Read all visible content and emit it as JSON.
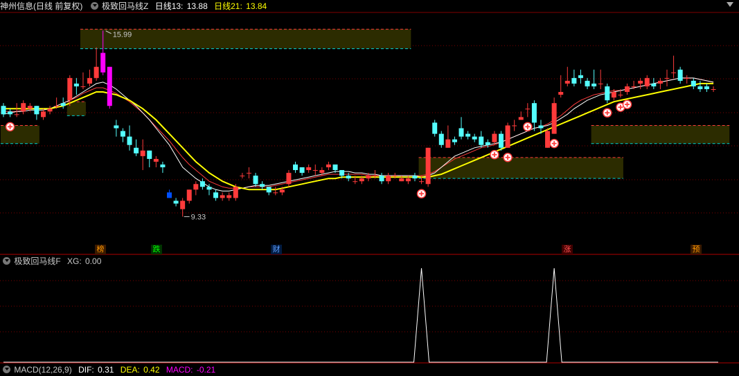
{
  "top_bar": {
    "stock_label": "神州信息(日线 前复权)",
    "indicator_name": "极致回马线Z",
    "ma13_label": "日线13:",
    "ma13_value": "13.88",
    "ma21_label": "日线21:",
    "ma21_value": "13.84"
  },
  "sub_bar": {
    "indicator_name": "极致回马线F",
    "xg_label": "XG:",
    "xg_value": "0.00"
  },
  "macd_bar": {
    "name": "MACD(12,26,9)",
    "dif_label": "DIF:",
    "dif_value": "0.31",
    "dea_label": "DEA:",
    "dea_value": "0.42",
    "macd_label": "MACD:",
    "macd_value": "-0.21"
  },
  "colors": {
    "up": "#ff3b3b",
    "down": "#54ffff",
    "ma_white": "#ffffff",
    "ma_yellow": "#ffff00",
    "ma_red": "#ff3b3b",
    "magenta": "#ff00ff",
    "zone_fill": "#2c2c00",
    "zone_top": "#ff3b3b",
    "zone_bottom": "#00d0d0",
    "grid": "#800000"
  },
  "chart_data": {
    "type": "candlestick",
    "price_range": [
      8.5,
      16.6
    ],
    "annotations": [
      {
        "text": "15.99",
        "value": 15.99,
        "kind": "high"
      },
      {
        "text": "9.33",
        "value": 9.33,
        "kind": "low"
      }
    ],
    "event_markers": [
      "榜",
      "跌",
      "财",
      "涨",
      "预"
    ],
    "candles": [
      [
        13.3,
        13.0,
        13.4,
        12.9
      ],
      [
        13.1,
        13.0,
        13.2,
        12.9
      ],
      [
        13.0,
        13.0,
        13.4,
        12.9
      ],
      [
        13.1,
        13.4,
        13.5,
        13.0
      ],
      [
        13.2,
        13.3,
        13.4,
        13.1
      ],
      [
        13.3,
        13.0,
        13.3,
        12.8
      ],
      [
        12.9,
        13.1,
        13.2,
        12.8
      ],
      [
        13.1,
        13.2,
        13.3,
        13.0
      ],
      [
        13.3,
        13.3,
        13.6,
        13.2
      ],
      [
        13.4,
        13.3,
        13.6,
        13.2
      ],
      [
        13.5,
        14.3,
        14.4,
        13.3
      ],
      [
        14.1,
        14.0,
        14.3,
        13.7
      ],
      [
        14.0,
        14.0,
        14.5,
        13.9
      ],
      [
        14.1,
        14.3,
        14.6,
        14.0
      ],
      [
        14.3,
        14.7,
        15.4,
        14.2
      ],
      [
        15.2,
        14.5,
        16.0,
        14.4
      ],
      [
        14.7,
        13.3,
        14.7,
        13.2
      ],
      [
        12.6,
        12.5,
        12.8,
        12.2
      ],
      [
        12.4,
        12.2,
        12.5,
        12.0
      ],
      [
        12.2,
        11.9,
        12.6,
        11.7
      ],
      [
        11.8,
        11.6,
        12.1,
        11.5
      ],
      [
        11.5,
        11.7,
        12.1,
        11.0
      ],
      [
        11.7,
        11.4,
        11.7,
        11.1
      ],
      [
        11.3,
        11.4,
        11.5,
        11.1
      ],
      [
        11.2,
        11.1,
        11.3,
        10.9
      ],
      [
        10.2,
        10.0,
        10.3,
        10.0
      ],
      [
        9.9,
        9.8,
        10.0,
        9.7
      ],
      [
        9.6,
        9.9,
        10.0,
        9.33
      ],
      [
        9.9,
        10.3,
        10.3,
        9.8
      ],
      [
        10.3,
        10.5,
        10.6,
        10.1
      ],
      [
        10.6,
        10.4,
        10.7,
        10.3
      ],
      [
        10.4,
        10.3,
        10.5,
        10.1
      ],
      [
        10.2,
        10.0,
        10.3,
        9.9
      ],
      [
        10.0,
        10.1,
        10.2,
        9.9
      ],
      [
        10.0,
        10.1,
        10.2,
        9.9
      ],
      [
        10.0,
        10.4,
        10.5,
        9.9
      ],
      [
        10.8,
        10.8,
        10.9,
        10.7
      ],
      [
        10.9,
        10.9,
        11.1,
        10.7
      ],
      [
        10.8,
        10.5,
        10.9,
        10.4
      ],
      [
        10.5,
        10.4,
        10.6,
        10.3
      ],
      [
        10.4,
        10.2,
        10.4,
        10.1
      ],
      [
        10.2,
        10.2,
        10.4,
        10.1
      ],
      [
        10.2,
        10.3,
        10.4,
        10.1
      ],
      [
        10.5,
        10.9,
        11.0,
        10.4
      ],
      [
        11.2,
        11.0,
        11.3,
        10.9
      ],
      [
        11.1,
        10.9,
        11.1,
        10.8
      ],
      [
        11.0,
        11.1,
        11.2,
        10.9
      ],
      [
        11.0,
        11.0,
        11.2,
        10.8
      ],
      [
        10.9,
        11.0,
        11.1,
        10.8
      ],
      [
        11.1,
        11.2,
        11.3,
        11.0
      ],
      [
        11.2,
        11.0,
        11.2,
        10.9
      ],
      [
        11.0,
        10.8,
        11.0,
        10.7
      ],
      [
        10.8,
        10.7,
        10.9,
        10.6
      ],
      [
        10.6,
        10.6,
        10.8,
        10.5
      ],
      [
        10.6,
        10.7,
        10.8,
        10.5
      ],
      [
        10.7,
        10.8,
        10.9,
        10.6
      ],
      [
        10.8,
        10.8,
        11.0,
        10.7
      ],
      [
        10.8,
        10.6,
        10.9,
        10.5
      ],
      [
        10.6,
        10.8,
        10.9,
        10.5
      ],
      [
        10.8,
        10.8,
        10.9,
        10.7
      ],
      [
        10.6,
        10.7,
        10.8,
        10.6
      ],
      [
        10.6,
        10.7,
        10.8,
        10.5
      ],
      [
        10.8,
        10.7,
        10.9,
        10.6
      ],
      [
        10.6,
        10.6,
        10.8,
        10.5
      ],
      [
        10.5,
        11.8,
        11.8,
        10.4
      ],
      [
        12.7,
        12.3,
        12.8,
        12.2
      ],
      [
        12.3,
        11.9,
        12.4,
        11.8
      ],
      [
        11.8,
        12.1,
        12.6,
        11.8
      ],
      [
        12.1,
        12.0,
        12.2,
        11.9
      ],
      [
        12.5,
        12.2,
        12.9,
        12.1
      ],
      [
        12.3,
        12.2,
        12.4,
        12.1
      ],
      [
        12.2,
        12.1,
        12.3,
        12.0
      ],
      [
        12.2,
        11.9,
        12.4,
        11.8
      ],
      [
        12.0,
        11.9,
        12.1,
        11.8
      ],
      [
        12.0,
        12.3,
        12.4,
        11.9
      ],
      [
        12.3,
        11.8,
        12.4,
        11.7
      ],
      [
        11.8,
        12.6,
        12.7,
        11.8
      ],
      [
        12.6,
        12.6,
        12.8,
        12.4
      ],
      [
        12.8,
        12.9,
        13.1,
        12.8
      ],
      [
        13.2,
        13.2,
        13.4,
        12.9
      ],
      [
        13.4,
        12.7,
        13.5,
        12.4
      ],
      [
        12.6,
        12.5,
        12.8,
        12.3
      ],
      [
        11.8,
        12.4,
        12.5,
        11.8
      ],
      [
        12.3,
        13.4,
        13.6,
        12.3
      ],
      [
        13.7,
        13.8,
        14.4,
        13.6
      ],
      [
        14.1,
        14.2,
        14.7,
        14.0
      ],
      [
        14.3,
        14.1,
        14.6,
        14.0
      ],
      [
        14.4,
        14.3,
        14.6,
        14.1
      ],
      [
        14.2,
        14.0,
        14.3,
        13.9
      ],
      [
        14.1,
        14.0,
        14.6,
        13.9
      ],
      [
        14.1,
        14.1,
        14.6,
        13.9
      ],
      [
        14.0,
        13.5,
        14.1,
        13.4
      ],
      [
        13.6,
        13.8,
        13.9,
        13.5
      ],
      [
        13.7,
        13.7,
        13.9,
        13.6
      ],
      [
        13.8,
        14.0,
        14.1,
        13.7
      ],
      [
        14.0,
        14.0,
        14.2,
        13.9
      ],
      [
        14.1,
        14.2,
        14.3,
        13.9
      ],
      [
        14.0,
        14.3,
        14.4,
        13.9
      ],
      [
        14.1,
        14.0,
        14.3,
        13.9
      ],
      [
        14.1,
        14.2,
        14.3,
        13.9
      ],
      [
        14.3,
        14.3,
        14.6,
        14.0
      ],
      [
        14.5,
        14.5,
        15.1,
        14.3
      ],
      [
        14.6,
        14.2,
        14.7,
        14.1
      ],
      [
        14.3,
        14.3,
        14.4,
        14.1
      ],
      [
        14.2,
        14.0,
        14.3,
        13.9
      ],
      [
        14.0,
        13.9,
        14.2,
        13.8
      ],
      [
        14.0,
        13.9,
        14.1,
        13.8
      ],
      [
        13.9,
        13.9,
        14.0,
        13.8
      ]
    ],
    "ma_white": [
      13.0,
      13.05,
      13.1,
      13.1,
      13.15,
      13.15,
      13.15,
      13.2,
      13.3,
      13.4,
      13.5,
      13.65,
      13.8,
      13.95,
      14.1,
      14.15,
      14.05,
      13.9,
      13.7,
      13.5,
      13.3,
      13.05,
      12.8,
      12.5,
      12.2,
      11.9,
      11.5,
      11.1,
      10.9,
      10.7,
      10.55,
      10.4,
      10.3,
      10.25,
      10.25,
      10.3,
      10.35,
      10.4,
      10.45,
      10.45,
      10.45,
      10.5,
      10.55,
      10.6,
      10.65,
      10.7,
      10.75,
      10.8,
      10.85,
      10.9,
      10.95,
      10.95,
      10.95,
      10.9,
      10.9,
      10.85,
      10.85,
      10.8,
      10.8,
      10.8,
      10.8,
      10.8,
      10.8,
      10.75,
      10.8,
      10.9,
      11.1,
      11.3,
      11.5,
      11.6,
      11.7,
      11.8,
      11.85,
      11.9,
      11.95,
      12.0,
      12.1,
      12.2,
      12.3,
      12.4,
      12.5,
      12.55,
      12.6,
      12.7,
      12.85,
      13.0,
      13.2,
      13.35,
      13.5,
      13.6,
      13.7,
      13.75,
      13.8,
      13.85,
      13.9,
      13.95,
      14.0,
      14.05,
      14.1,
      14.15,
      14.2,
      14.25,
      14.3,
      14.3,
      14.3,
      14.25,
      14.2,
      14.15
    ],
    "ma_yellow": [
      13.2,
      13.2,
      13.2,
      13.2,
      13.2,
      13.2,
      13.2,
      13.2,
      13.25,
      13.3,
      13.4,
      13.5,
      13.6,
      13.7,
      13.8,
      13.8,
      13.75,
      13.7,
      13.6,
      13.5,
      13.35,
      13.2,
      13.0,
      12.8,
      12.55,
      12.3,
      12.05,
      11.8,
      11.55,
      11.3,
      11.1,
      10.9,
      10.75,
      10.6,
      10.5,
      10.4,
      10.35,
      10.3,
      10.3,
      10.3,
      10.3,
      10.3,
      10.35,
      10.4,
      10.45,
      10.5,
      10.55,
      10.6,
      10.65,
      10.7,
      10.7,
      10.75,
      10.75,
      10.75,
      10.75,
      10.75,
      10.75,
      10.75,
      10.75,
      10.75,
      10.75,
      10.75,
      10.75,
      10.75,
      10.75,
      10.8,
      10.85,
      10.95,
      11.05,
      11.15,
      11.25,
      11.35,
      11.45,
      11.55,
      11.65,
      11.75,
      11.85,
      11.95,
      12.05,
      12.15,
      12.25,
      12.35,
      12.45,
      12.55,
      12.65,
      12.75,
      12.85,
      12.95,
      13.05,
      13.15,
      13.25,
      13.35,
      13.45,
      13.5,
      13.55,
      13.6,
      13.65,
      13.7,
      13.75,
      13.8,
      13.85,
      13.9,
      13.95,
      14.0,
      14.05,
      14.1,
      14.1,
      14.1
    ],
    "ma_red": [
      13.1,
      13.1,
      13.1,
      13.15,
      13.2,
      13.2,
      13.2,
      13.2,
      13.3,
      13.4,
      13.5,
      13.6,
      13.75,
      13.85,
      13.95,
      13.95,
      13.85,
      13.75,
      13.6,
      13.45,
      13.25,
      13.05,
      12.8,
      12.55,
      12.3,
      12.05,
      11.75,
      11.45,
      11.2,
      11.0,
      10.8,
      10.6,
      10.5,
      10.4,
      10.35,
      10.35,
      10.35,
      10.4,
      10.4,
      10.4,
      10.4,
      10.45,
      10.5,
      10.55,
      10.6,
      10.65,
      10.7,
      10.75,
      10.8,
      10.85,
      10.85,
      10.85,
      10.85,
      10.85,
      10.85,
      10.8,
      10.8,
      10.8,
      10.8,
      10.8,
      10.8,
      10.8,
      10.8,
      10.8,
      10.85,
      10.95,
      11.1,
      11.25,
      11.4,
      11.5,
      11.6,
      11.7,
      11.8,
      11.85,
      11.9,
      12.0,
      12.1,
      12.2,
      12.3,
      12.4,
      12.5,
      12.55,
      12.65,
      12.8,
      12.95,
      13.15,
      13.35,
      13.5,
      13.6,
      13.7,
      13.75,
      13.8,
      13.85,
      13.85,
      13.9,
      13.95,
      14.0,
      14.05,
      14.1,
      14.15,
      14.2,
      14.25,
      14.3,
      14.3,
      14.3,
      14.25,
      14.2,
      14.15
    ],
    "zones": [
      {
        "start": 0,
        "end": 5,
        "top": 12.6,
        "bottom": 11.95
      },
      {
        "start": 10,
        "end": 12,
        "top": 13.45,
        "bottom": 12.95
      },
      {
        "start": 12,
        "end": 61,
        "top": 16.05,
        "bottom": 15.35
      },
      {
        "start": 63,
        "end": 93,
        "top": 11.45,
        "bottom": 10.7
      },
      {
        "start": 89,
        "end": 109,
        "top": 12.6,
        "bottom": 11.95
      }
    ],
    "xg_signal_indices": [
      63,
      83
    ]
  }
}
